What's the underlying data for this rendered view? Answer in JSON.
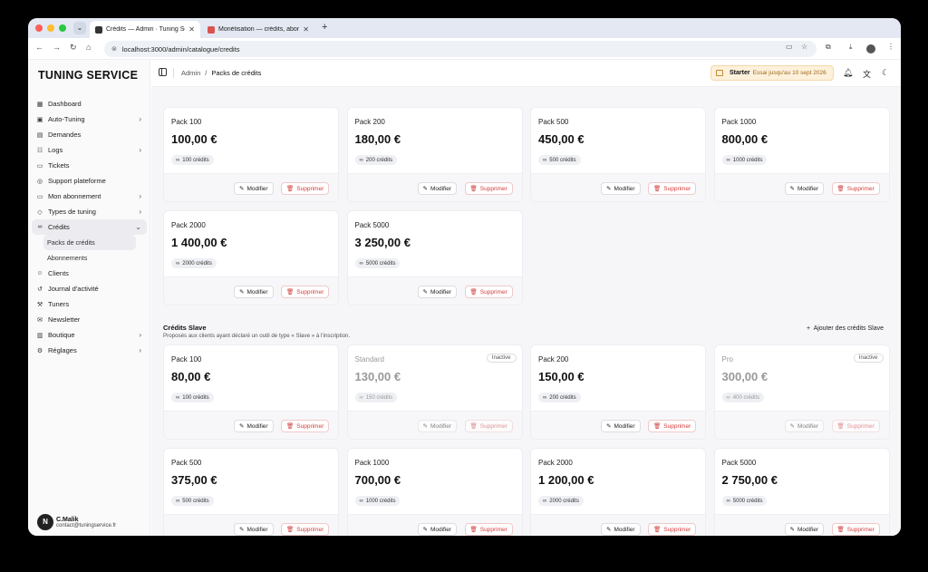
{
  "browser": {
    "tabs": [
      {
        "title": "Crédits — Admin · Tuning Service",
        "active": true
      },
      {
        "title": "Monétisation — crédits, abon",
        "active": false
      }
    ],
    "url": "localhost:3000/admin/catalogue/credits"
  },
  "sidebar": {
    "brand": "TUNING SERVICE",
    "items": [
      {
        "label": "Dashboard",
        "icon": "grid-icon",
        "chevron": false
      },
      {
        "label": "Auto-Tuning",
        "icon": "cpu-icon",
        "chevron": true
      },
      {
        "label": "Demandes",
        "icon": "file-icon",
        "chevron": false
      },
      {
        "label": "Logs",
        "icon": "logs-icon",
        "chevron": true
      },
      {
        "label": "Tickets",
        "icon": "ticket-icon",
        "chevron": false
      },
      {
        "label": "Support plateforme",
        "icon": "support-icon",
        "chevron": false
      },
      {
        "label": "Mon abonnement",
        "icon": "card-icon",
        "chevron": true
      },
      {
        "label": "Types de tuning",
        "icon": "tag-icon",
        "chevron": true
      },
      {
        "label": "Crédits",
        "icon": "link-icon",
        "chevron": true,
        "open": true,
        "children": [
          {
            "label": "Packs de crédits",
            "active": true
          },
          {
            "label": "Abonnements"
          }
        ]
      },
      {
        "label": "Clients",
        "icon": "users-icon",
        "chevron": false
      },
      {
        "label": "Journal d'activité",
        "icon": "history-icon",
        "chevron": false
      },
      {
        "label": "Tuners",
        "icon": "wrench-icon",
        "chevron": false
      },
      {
        "label": "Newsletter",
        "icon": "mail-icon",
        "chevron": false
      },
      {
        "label": "Boutique",
        "icon": "shop-icon",
        "chevron": true
      },
      {
        "label": "Réglages",
        "icon": "gear-icon",
        "chevron": true
      }
    ],
    "user": {
      "initial": "N",
      "name": "C.Malik",
      "email": "contact@tuningservice.fr"
    }
  },
  "header": {
    "breadcrumb_root": "Admin",
    "breadcrumb_sep": "/",
    "breadcrumb_current": "Packs de crédits",
    "plan_name": "Starter",
    "plan_text": "Essai jusqu'au 10 sept 2026"
  },
  "buttons": {
    "edit": "Modifier",
    "delete": "Supprimer"
  },
  "packs_master": [
    {
      "name": "Pack 100",
      "price": "100,00 €",
      "credits": "100 crédits"
    },
    {
      "name": "Pack 200",
      "price": "180,00 €",
      "credits": "200 crédits"
    },
    {
      "name": "Pack 500",
      "price": "450,00 €",
      "credits": "500 crédits"
    },
    {
      "name": "Pack 1000",
      "price": "800,00 €",
      "credits": "1000 crédits"
    },
    {
      "name": "Pack 2000",
      "price": "1 400,00 €",
      "credits": "2000 crédits"
    },
    {
      "name": "Pack 5000",
      "price": "3 250,00 €",
      "credits": "5000 crédits"
    }
  ],
  "slave_section": {
    "title": "Crédits Slave",
    "description": "Proposés aux clients ayant déclaré un outil de type « Slave » à l'inscription.",
    "add_label": "Ajouter des crédits Slave"
  },
  "packs_slave": [
    {
      "name": "Pack 100",
      "price": "80,00 €",
      "credits": "100 crédits",
      "inactive": false
    },
    {
      "name": "Standard",
      "price": "130,00 €",
      "credits": "150 crédits",
      "inactive": true,
      "badge": "Inactive"
    },
    {
      "name": "Pack 200",
      "price": "150,00 €",
      "credits": "200 crédits",
      "inactive": false
    },
    {
      "name": "Pro",
      "price": "300,00 €",
      "credits": "400 crédits",
      "inactive": true,
      "badge": "Inactive"
    },
    {
      "name": "Pack 500",
      "price": "375,00 €",
      "credits": "500 crédits",
      "inactive": false
    },
    {
      "name": "Pack 1000",
      "price": "700,00 €",
      "credits": "1000 crédits",
      "inactive": false
    },
    {
      "name": "Pack 2000",
      "price": "1 200,00 €",
      "credits": "2000 crédits",
      "inactive": false
    },
    {
      "name": "Pack 5000",
      "price": "2 750,00 €",
      "credits": "5000 crédits",
      "inactive": false
    }
  ]
}
